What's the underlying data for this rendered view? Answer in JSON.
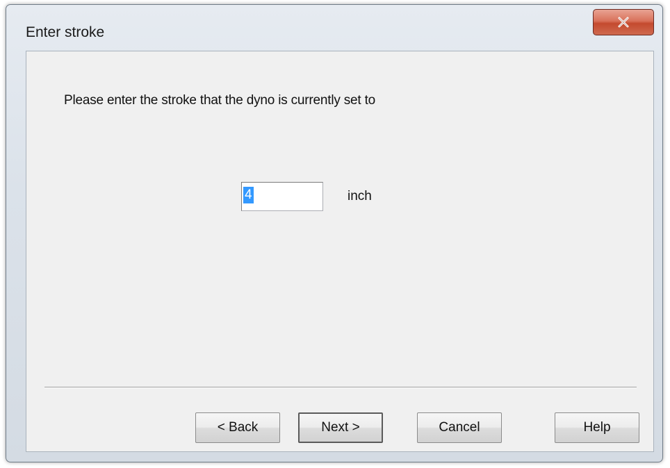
{
  "window": {
    "title": "Enter stroke",
    "close_icon": "close-x-icon"
  },
  "dialog": {
    "prompt": "Please enter the stroke that the dyno is currently set to",
    "stroke_value": "4",
    "unit": "inch"
  },
  "buttons": {
    "back": "< Back",
    "next": "Next >",
    "cancel": "Cancel",
    "help": "Help"
  },
  "colors": {
    "close_button": "#c44a2f",
    "selection": "#3399ff"
  }
}
